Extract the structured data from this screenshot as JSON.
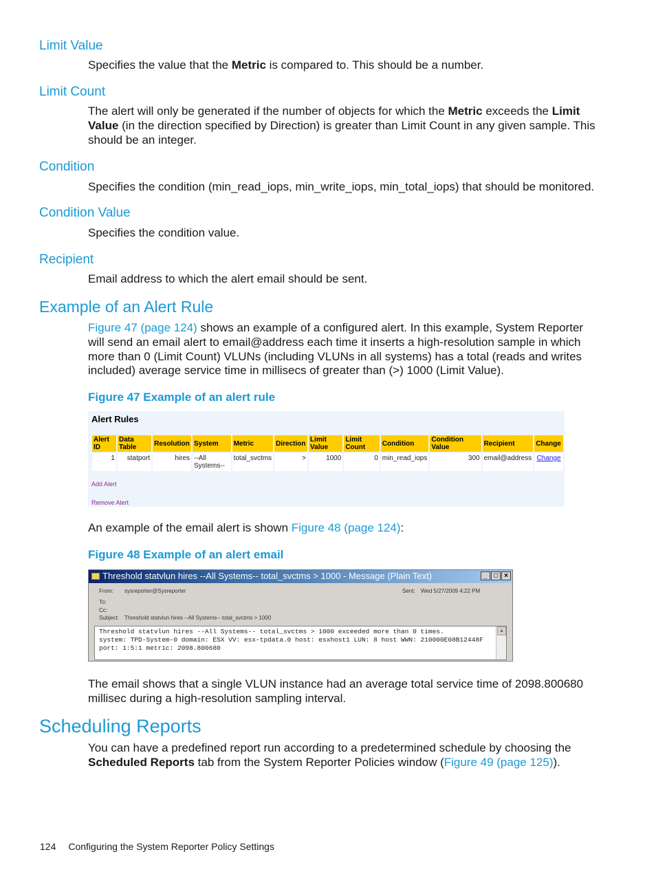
{
  "definitions": [
    {
      "term": "Limit Value",
      "desc_html_parts": [
        "Specifies the value that the ",
        "Metric",
        " is compared to. This should be a number."
      ]
    },
    {
      "term": "Limit Count",
      "desc_parts": [
        "The alert will only be generated if the number of objects for which the ",
        "Metric",
        " exceeds the ",
        "Limit Value",
        " (in the direction specified by Direction) is greater than Limit Count in any given sample. This should be an integer."
      ]
    },
    {
      "term": "Condition",
      "desc": "Specifies the condition (min_read_iops, min_write_iops, min_total_iops) that should be monitored."
    },
    {
      "term": "Condition Value",
      "desc": "Specifies the condition value."
    },
    {
      "term": "Recipient",
      "desc": "Email address to which the alert email should be sent."
    }
  ],
  "example_section": {
    "heading": "Example of an Alert Rule",
    "para_link": "Figure 47 (page 124)",
    "para_rest": " shows an example of a configured alert. In this example, System Reporter will send an email alert to email@address each time it inserts a high-resolution sample in which more than 0 (Limit Count) VLUNs (including VLUNs in all systems) has a total (reads and writes included) average service time in millisecs of greater than (>) 1000 (Limit Value).",
    "figure47_caption": "Figure 47 Example of an alert rule",
    "alert_rules": {
      "title": "Alert Rules",
      "columns": [
        "Alert ID",
        "Data Table",
        "Resolution",
        "System",
        "Metric",
        "Direction",
        "Limit Value",
        "Limit Count",
        "Condition",
        "Condition Value",
        "Recipient",
        "Change"
      ],
      "rows": [
        [
          "1",
          "statport",
          "hires",
          "--All Systems--",
          "total_svctms",
          ">",
          "1000",
          "0",
          "min_read_iops",
          "300",
          "email@address",
          "Change"
        ]
      ],
      "add_link": "Add Alert",
      "remove_link": "Remove Alert"
    },
    "email_para_pre": "An example of the email alert is shown ",
    "email_para_link": "Figure 48 (page 124)",
    "email_para_post": ":",
    "figure48_caption": "Figure 48 Example of an alert email",
    "email_window": {
      "title": "Threshold statvlun hires --All Systems-- total_svctms > 1000 - Message (Plain Text)",
      "buttons": {
        "minimize": "_",
        "maximize": "□",
        "close": "×"
      },
      "from_label": "From:",
      "from_value": "sysreporter@Sysreporter",
      "sent_label": "Sent:",
      "sent_value": "Wed 5/27/2009 4:22 PM",
      "to_label": "To:",
      "cc_label": "Cc:",
      "subject_label": "Subject:",
      "subject_value": "Threshold statvlun hires --All Systems-- total_svctms > 1000",
      "body_lines": [
        "Threshold statvlun hires --All Systems-- total_svctms > 1000 exceeded more than 0 times.",
        "system: TPD-System-0 domain: ESX VV: esx-tpdata.0 host: esxhost1 LUN: 8 host WWN: 210000E08B12448F",
        "port: 1:5:1 metric: 2098.800680"
      ]
    },
    "closing_para": "The email shows that a single VLUN instance had an average total service time of 2098.800680 millisec during a high-resolution sampling interval."
  },
  "scheduling_section": {
    "heading": "Scheduling Reports",
    "para_pre": "You can have a predefined report run according to a predetermined schedule by choosing the ",
    "para_bold": "Scheduled Reports",
    "para_mid": " tab from the System Reporter Policies window (",
    "para_link": "Figure 49 (page 125)",
    "para_post": ")."
  },
  "footer": {
    "page_number": "124",
    "chapter_title": "Configuring the System Reporter Policy Settings"
  },
  "colors": {
    "accent": "#1a9ad6",
    "table_header": "#ffcc00",
    "panel_bg": "#eef4fc"
  }
}
